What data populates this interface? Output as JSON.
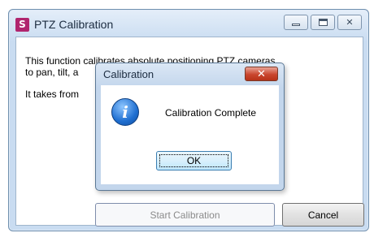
{
  "main_window": {
    "title": "PTZ Calibration",
    "app_icon_glyph": "S",
    "description_line1": "This function calibrates absolute positioning PTZ cameras",
    "description_line2": "to pan, tilt, a",
    "description_line3": "It takes from",
    "start_button_label": "Start Calibration",
    "cancel_button_label": "Cancel"
  },
  "dialog": {
    "title": "Calibration",
    "message": "Calibration Complete",
    "ok_button_label": "OK",
    "close_glyph": "✕",
    "icon_glyph": "i"
  },
  "icons": {
    "app": "app-logo-icon",
    "info": "info-icon",
    "close": "close-icon",
    "minimize": "minimize-icon",
    "maximize": "maximize-icon"
  },
  "colors": {
    "app_icon": "#b0256e",
    "close_button": "#c9462e",
    "info_icon": "#1f6fd1"
  }
}
